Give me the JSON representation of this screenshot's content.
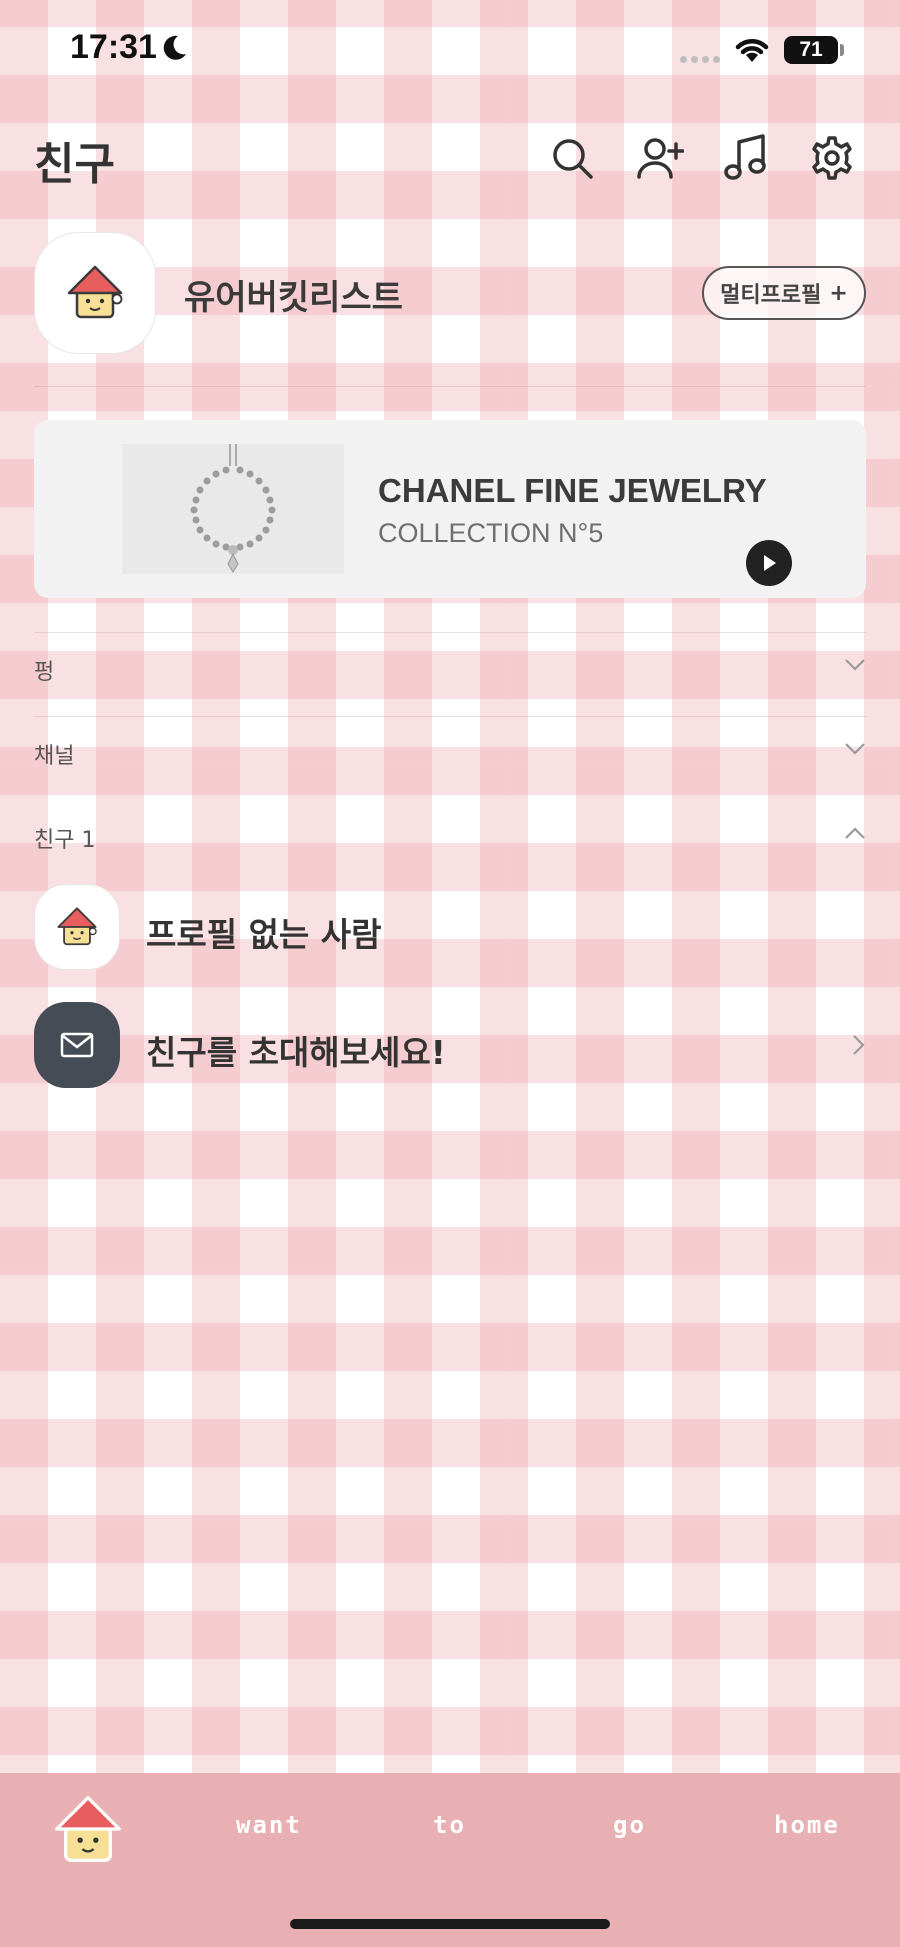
{
  "status_bar": {
    "time": "17:31",
    "battery": "71"
  },
  "header": {
    "title": "친구"
  },
  "my_profile": {
    "name": "유어버킷리스트",
    "multi_profile_label": "멀티프로필",
    "plus": "+"
  },
  "ad": {
    "title": "CHANEL FINE JEWELRY",
    "subtitle": "COLLECTION N°5"
  },
  "sections": [
    {
      "label": "펑",
      "expanded": false
    },
    {
      "label": "채널",
      "expanded": false
    },
    {
      "label": "친구 1",
      "expanded": true
    }
  ],
  "friends": [
    {
      "name": "프로필 없는 사람"
    },
    {
      "name": "친구를 초대해보세요!"
    }
  ],
  "tab_bar": {
    "labels": [
      "want",
      "to",
      "go",
      "home"
    ]
  },
  "icons": {
    "header": [
      "search-icon",
      "add-friend-icon",
      "music-icon",
      "settings-icon"
    ],
    "avatar": "house-character-icon"
  },
  "colors": {
    "tab_bar": "#e8b0b2",
    "gingham": "#eca0a8",
    "invite_avatar": "#454c55"
  }
}
